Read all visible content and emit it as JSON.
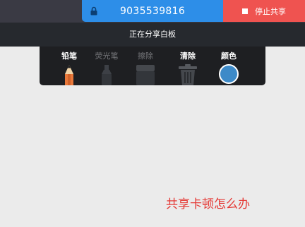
{
  "share_bar": {
    "meeting_id": "9035539816",
    "stop_label": "停止共享",
    "lock_icon": "lock-icon"
  },
  "status": {
    "text": "正在分享白板"
  },
  "toolbar": {
    "tools": [
      {
        "label": "铅笔",
        "icon": "pencil-icon",
        "enabled": true
      },
      {
        "label": "荧光笔",
        "icon": "highlighter-icon",
        "enabled": false
      },
      {
        "label": "擦除",
        "icon": "eraser-icon",
        "enabled": false
      },
      {
        "label": "清除",
        "icon": "trash-icon",
        "enabled": true
      },
      {
        "label": "颜色",
        "icon": "color-swatch-icon",
        "enabled": true
      }
    ],
    "selected_color": "#3d8ac8"
  },
  "hint_text": "共享卡顿怎么办",
  "colors": {
    "meeting_id_bg": "#2d8ee8",
    "stop_bg": "#ef5350",
    "hint": "#e53935"
  }
}
